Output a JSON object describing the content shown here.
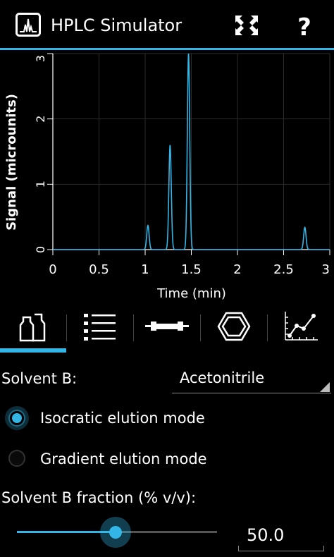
{
  "app": {
    "title": "HPLC Simulator"
  },
  "actions": [
    {
      "icon": "fit-screen-icon"
    },
    {
      "icon": "help-icon"
    }
  ],
  "chart_data": {
    "type": "line",
    "xlabel": "Time (min)",
    "ylabel": "Signal (microunits)",
    "xlim": [
      0,
      3
    ],
    "ylim": [
      0,
      3
    ],
    "x_ticks": [
      "0",
      "0.5",
      "1",
      "1.5",
      "2",
      "2.5",
      "3"
    ],
    "y_ticks": [
      "0",
      "1",
      "2",
      "3"
    ],
    "grid": true,
    "line_color": "#33b5e5",
    "peaks": [
      {
        "time": 1.03,
        "height": 0.37
      },
      {
        "time": 1.27,
        "height": 1.6
      },
      {
        "time": 1.47,
        "height": 3.0
      },
      {
        "time": 2.73,
        "height": 0.34
      }
    ]
  },
  "tabs": [
    {
      "icon": "solvent-bottles-icon",
      "selected": true
    },
    {
      "icon": "list-icon",
      "selected": false
    },
    {
      "icon": "column-icon",
      "selected": false
    },
    {
      "icon": "compound-icon",
      "selected": false
    },
    {
      "icon": "chart-icon",
      "selected": false
    }
  ],
  "form": {
    "solvent_label": "Solvent B:",
    "solvent_value": "Acetonitrile",
    "isocratic_label": "Isocratic elution mode",
    "gradient_label": "Gradient elution mode",
    "fraction_label": "Solvent B fraction (% v/v):",
    "fraction_value": "50.0",
    "slider_level": 0.5
  },
  "colors": {
    "accent": "#33b5e5"
  }
}
